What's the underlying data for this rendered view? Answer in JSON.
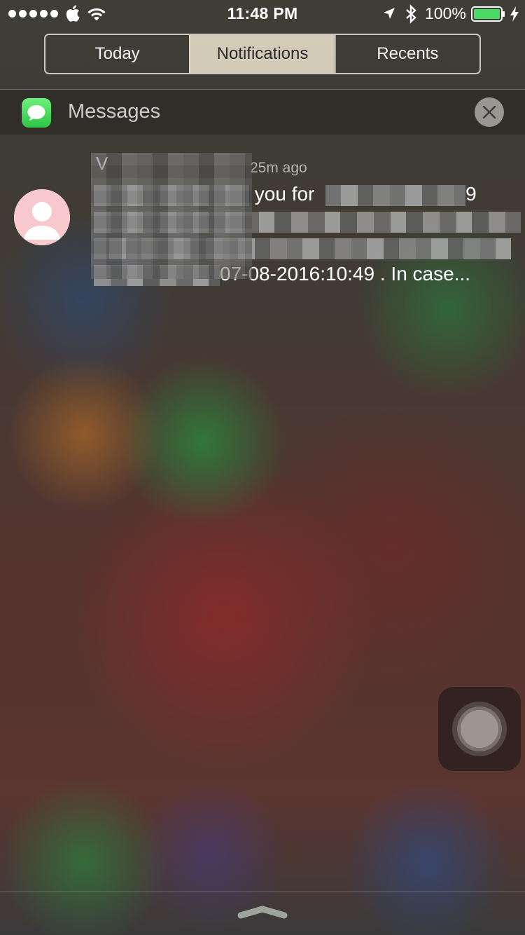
{
  "status_bar": {
    "time": "11:48 PM",
    "battery_percent": "100%",
    "signal_bars": 5,
    "icons": [
      "apple-icon",
      "wifi-icon",
      "location-icon",
      "bluetooth-icon",
      "battery-icon",
      "charging-icon"
    ],
    "battery_color": "#4cd964"
  },
  "tabs": {
    "items": [
      "Today",
      "Notifications",
      "Recents"
    ],
    "selected": "Notifications"
  },
  "group": {
    "app_name": "Messages",
    "app_icon": "messages-app-icon",
    "clear_icon": "close-icon",
    "app_color": "#34c759"
  },
  "notification": {
    "sender": "V",
    "time_ago": "25m ago",
    "line1_visible": "you for",
    "line1_end": "9",
    "line4_visible": "07-08-2016:10:49 . In case...",
    "avatar_icon": "person-icon",
    "avatar_color": "#f7c8cc"
  },
  "assistive_touch": {
    "icon": "assistive-touch-icon"
  },
  "footer": {
    "grabber_icon": "chevron-up-icon"
  }
}
